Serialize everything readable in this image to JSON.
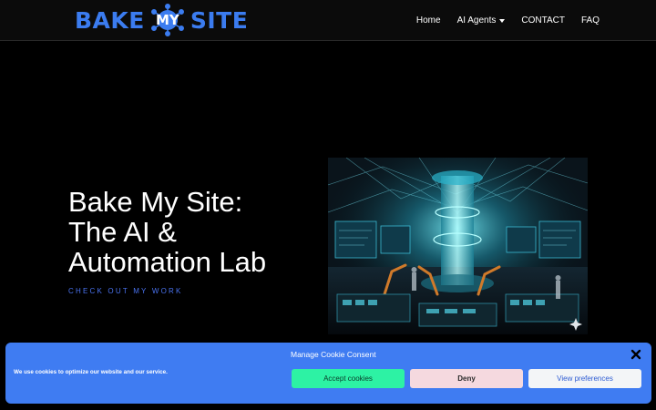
{
  "brand": {
    "left": "BAKE",
    "middle": "MY",
    "right": "SITE"
  },
  "nav": {
    "items": [
      {
        "label": "Home"
      },
      {
        "label": "AI Agents"
      },
      {
        "label": "CONTACT"
      },
      {
        "label": "FAQ"
      }
    ]
  },
  "hero": {
    "title_line1": "Bake My Site:",
    "title_line2": "The AI &",
    "title_line3": "Automation Lab",
    "cta": "CHECK OUT MY WORK"
  },
  "cookie": {
    "title": "Manage Cookie Consent",
    "text": "We use cookies to optimize our website and our service.",
    "accept": "Accept cookies",
    "deny": "Deny",
    "preferences": "View preferences"
  },
  "colors": {
    "brand_blue": "#3b7cf0",
    "cookie_bg": "#3f7cf2",
    "accept_bg": "#2df2a4",
    "deny_bg": "#f5d9df"
  }
}
